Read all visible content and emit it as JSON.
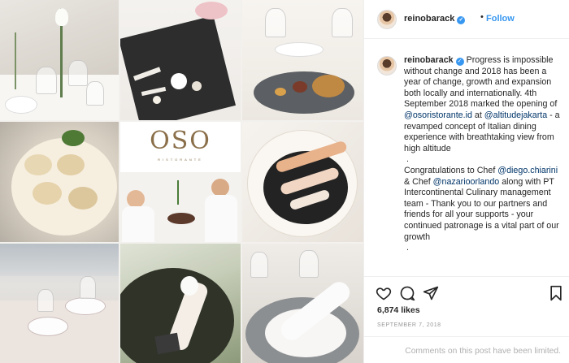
{
  "post": {
    "username": "reinobarack",
    "verified_mark": "✓",
    "separator": "•",
    "follow_label": "Follow",
    "caption": {
      "username": "reinobarack",
      "text_1": " Progress is impossible without change and 2018 has been a year of change, growth and expansion both locally and internationally. 4th September 2018 marked the opening of ",
      "mention_1": "@osoristorante.id",
      "text_2": " at ",
      "mention_2": "@altitudejakarta",
      "text_3": " - a revamped concept of Italian dining experience with breathtaking view from high altitude",
      "dot_1": ".",
      "text_4": "Congratulations to Chef ",
      "mention_3": "@diego.chiarini",
      "text_5": " & Chef ",
      "mention_4": "@nazarioorlando",
      "text_6": " along with PT Intercontinental Culinary management team - Thank you to our partners and friends for all your supports - your continued patronage is a vital part of our growth",
      "dot_2": "."
    },
    "likes": "6,874 likes",
    "date": "SEPTEMBER 7, 2018",
    "comments_disabled": "Comments on this post have been limited."
  },
  "collage": {
    "logo_text": "OSO",
    "logo_subtext": "RISTORANTE"
  },
  "icons": {
    "like": "heart-icon",
    "comment": "comment-icon",
    "share": "share-icon",
    "save": "bookmark-icon"
  },
  "colors": {
    "link": "#003569",
    "follow": "#3897f0",
    "verified": "#3897f0",
    "muted": "#999999"
  }
}
